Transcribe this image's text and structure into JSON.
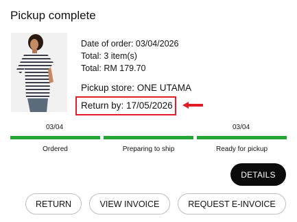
{
  "header": {
    "title": "Pickup complete"
  },
  "order": {
    "date_line": "Date of order: 03/04/2026",
    "total_items_line": "Total: 3 item(s)",
    "total_amount_line": "Total: RM 179.70",
    "pickup_store_line": "Pickup store: ONE UTAMA",
    "return_by_line": "Return by: 17/05/2026"
  },
  "progress": {
    "steps": [
      {
        "label": "Ordered",
        "date": "03/04",
        "complete": true
      },
      {
        "label": "Preparing to ship",
        "date": "",
        "complete": true
      },
      {
        "label": "Ready for pickup",
        "date": "03/04",
        "complete": true
      }
    ]
  },
  "actions": {
    "details_label": "DETAILS",
    "return_label": "RETURN",
    "view_invoice_label": "VIEW INVOICE",
    "request_einvoice_label": "REQUEST E-INVOICE"
  },
  "colors": {
    "progress_complete": "#23a534",
    "highlight_box": "#e11c24",
    "annotation_arrow": "#e11c24",
    "primary_button": "#0b0b0b"
  },
  "icons": {
    "annotation": "left-arrow-icon"
  }
}
